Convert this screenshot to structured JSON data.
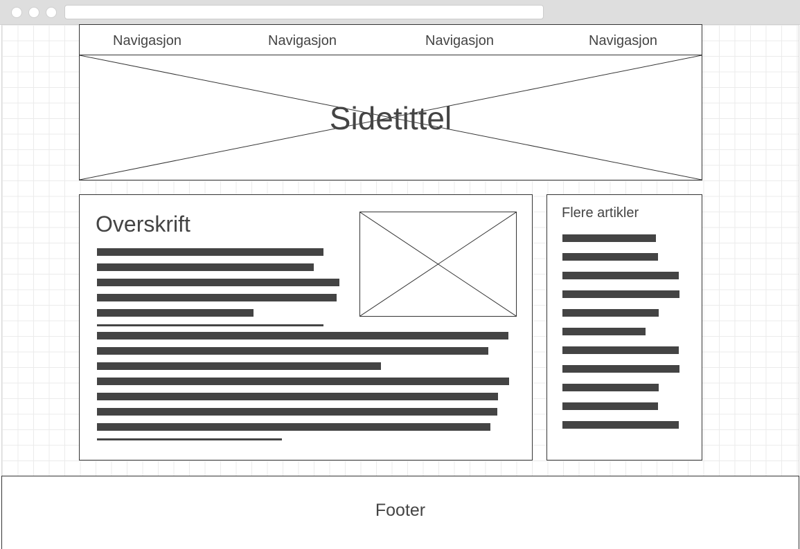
{
  "browser": {
    "controls": [
      "close-dot",
      "minimize-dot",
      "maximize-dot"
    ],
    "url": ""
  },
  "nav": {
    "items": [
      {
        "label": "Navigasjon"
      },
      {
        "label": "Navigasjon"
      },
      {
        "label": "Navigasjon"
      },
      {
        "label": "Navigasjon"
      }
    ]
  },
  "hero": {
    "title": "Sidetittel"
  },
  "article": {
    "heading": "Overskrift",
    "image_placeholder": "image-placeholder-icon"
  },
  "sidebar": {
    "title": "Flere artikler"
  },
  "footer": {
    "text": "Footer"
  },
  "colors": {
    "text": "#444444",
    "border": "#333333",
    "chrome": "#dedede",
    "grid": "#ebebeb"
  }
}
